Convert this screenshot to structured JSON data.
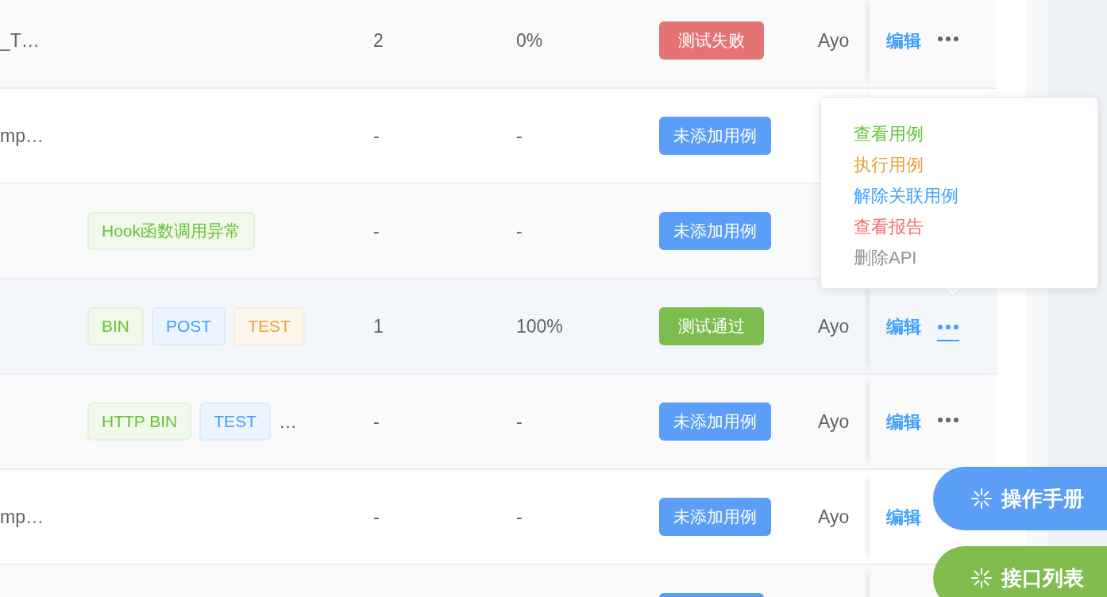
{
  "rows": [
    {
      "name": "_T…",
      "tags": [],
      "count": "2",
      "pass_rate": "0%",
      "status": {
        "text": "测试失败",
        "kind": "danger"
      },
      "owner": "Ayo",
      "edit": "编辑",
      "more": true,
      "menu_open": false,
      "hovered": false
    },
    {
      "name": "mp…",
      "tags": [],
      "count": "-",
      "pass_rate": "-",
      "status": {
        "text": "未添加用例",
        "kind": "primary"
      },
      "menu_open": false,
      "hovered": false
    },
    {
      "tags": [
        {
          "text": "Hook函数调用异常",
          "kind": "success"
        }
      ],
      "count": "-",
      "pass_rate": "-",
      "status": {
        "text": "未添加用例",
        "kind": "primary"
      },
      "menu_open": false
    },
    {
      "tags": [
        {
          "text": "BIN",
          "kind": "success"
        },
        {
          "text": "POST",
          "kind": "primary"
        },
        {
          "text": "TEST",
          "kind": "warning"
        }
      ],
      "count": "1",
      "pass_rate": "100%",
      "status": {
        "text": "测试通过",
        "kind": "success"
      },
      "owner": "Ayo",
      "edit": "编辑",
      "more": true,
      "menu_open": true,
      "hovered": true
    },
    {
      "tags": [
        {
          "text": "HTTP BIN",
          "kind": "success"
        },
        {
          "text": "TEST",
          "kind": "primary"
        }
      ],
      "tags_overflow": "…",
      "count": "-",
      "pass_rate": "-",
      "status": {
        "text": "未添加用例",
        "kind": "primary"
      },
      "owner": "Ayo",
      "edit": "编辑",
      "more": true,
      "menu_open": false,
      "hovered": false
    },
    {
      "name": "mp…",
      "tags": [],
      "count": "-",
      "pass_rate": "-",
      "status": {
        "text": "未添加用例",
        "kind": "primary"
      },
      "owner": "Ayo",
      "edit": "编辑",
      "more": false,
      "menu_open": false,
      "hovered": false
    },
    {
      "tags": [],
      "status": {
        "kind": "primary"
      }
    }
  ],
  "menu": {
    "items": [
      {
        "text": "查看用例",
        "color": "#67c23a"
      },
      {
        "text": "执行用例",
        "color": "#e6a23c"
      },
      {
        "text": "解除关联用例",
        "color": "#409eff"
      },
      {
        "text": "查看报告",
        "color": "#f56c6c"
      },
      {
        "text": "删除API",
        "color": "#909399"
      }
    ]
  },
  "float_buttons": [
    {
      "text": "操作手册",
      "kind": "primary"
    },
    {
      "text": "接口列表",
      "kind": "success"
    }
  ]
}
